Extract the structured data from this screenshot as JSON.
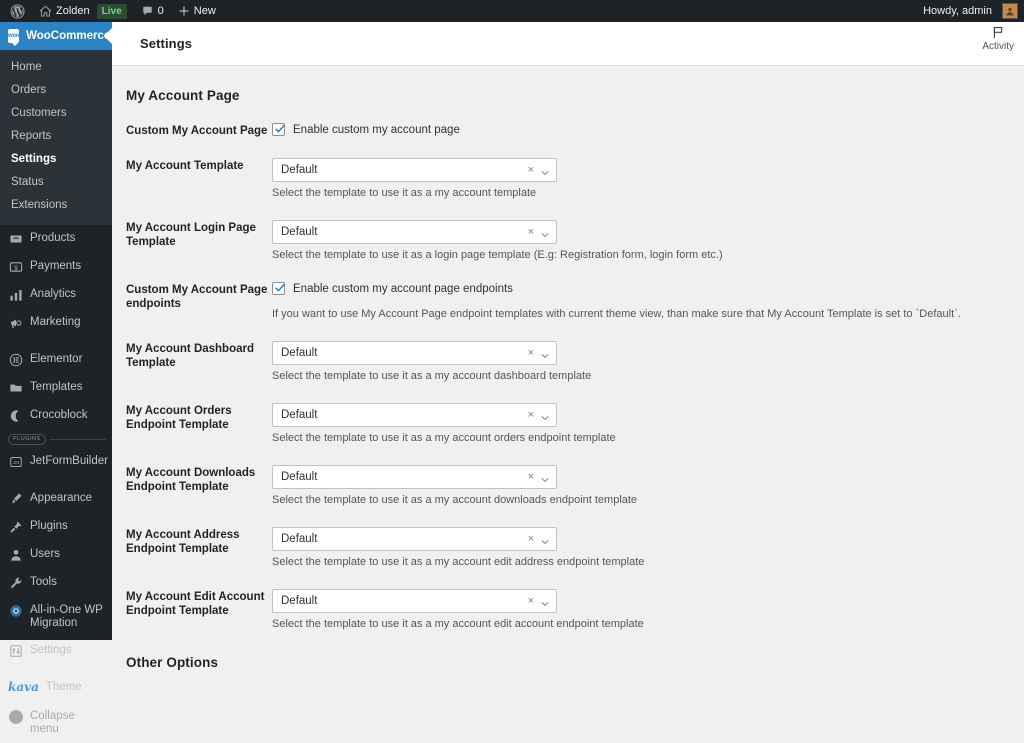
{
  "adminbar": {
    "wp_logo": "wordpress-logo-icon",
    "site_name": "Zolden",
    "live_badge": "Live",
    "comment_count": "0",
    "new_label": "New",
    "howdy": "Howdy, admin"
  },
  "sidebar": {
    "active_menu": "WooCommerce",
    "submenu": [
      {
        "label": "Home",
        "active": false
      },
      {
        "label": "Orders",
        "active": false
      },
      {
        "label": "Customers",
        "active": false
      },
      {
        "label": "Reports",
        "active": false
      },
      {
        "label": "Settings",
        "active": true
      },
      {
        "label": "Status",
        "active": false
      },
      {
        "label": "Extensions",
        "active": false
      }
    ],
    "group1": [
      {
        "label": "Products",
        "icon": "products-icon"
      },
      {
        "label": "Payments",
        "icon": "payments-icon"
      },
      {
        "label": "Analytics",
        "icon": "analytics-icon"
      },
      {
        "label": "Marketing",
        "icon": "marketing-megaphone-icon"
      }
    ],
    "group2": [
      {
        "label": "Elementor",
        "icon": "elementor-icon"
      },
      {
        "label": "Templates",
        "icon": "folder-icon"
      },
      {
        "label": "Crocoblock",
        "icon": "crocoblock-moon-icon"
      }
    ],
    "plugins_separator": "PLUGINS",
    "group3": [
      {
        "label": "JetFormBuilder",
        "icon": "jetformbuilder-icon"
      }
    ],
    "group4": [
      {
        "label": "Appearance",
        "icon": "appearance-brush-icon"
      },
      {
        "label": "Plugins",
        "icon": "plugins-plug-icon"
      },
      {
        "label": "Users",
        "icon": "users-icon"
      },
      {
        "label": "Tools",
        "icon": "tools-wrench-icon"
      },
      {
        "label": "All-in-One WP Migration",
        "icon": "migration-icon"
      },
      {
        "label": "Settings",
        "icon": "settings-sliders-icon"
      }
    ],
    "theme": {
      "brand": "kava",
      "label": "Theme"
    },
    "collapse": "Collapse menu"
  },
  "header": {
    "title": "Settings",
    "activity_label": "Activity",
    "activity_icon": "flag-icon"
  },
  "main": {
    "section_title": "My Account Page",
    "other_options_title": "Other Options",
    "select_clear_glyph": "×",
    "rows": [
      {
        "label": "Custom My Account Page",
        "type": "checkbox",
        "checked": true,
        "checkbox_label": "Enable custom my account page",
        "desc": ""
      },
      {
        "label": "My Account Template",
        "type": "select",
        "value": "Default",
        "desc": "Select the template to use it as a my account template"
      },
      {
        "label": "My Account Login Page Template",
        "type": "select",
        "value": "Default",
        "desc": "Select the template to use it as a login page template (E.g: Registration form, login form etc.)"
      },
      {
        "label": "Custom My Account Page endpoints",
        "type": "checkbox",
        "checked": true,
        "checkbox_label": "Enable custom my account page endpoints",
        "desc": "If you want to use My Account Page endpoint templates with current theme view, than make sure that My Account Template is set to `Default`."
      },
      {
        "label": "My Account Dashboard Template",
        "type": "select",
        "value": "Default",
        "desc": "Select the template to use it as a my account dashboard template"
      },
      {
        "label": "My Account Orders Endpoint Template",
        "type": "select",
        "value": "Default",
        "desc": "Select the template to use it as a my account orders endpoint template"
      },
      {
        "label": "My Account Downloads Endpoint Template",
        "type": "select",
        "value": "Default",
        "desc": "Select the template to use it as a my account downloads endpoint template"
      },
      {
        "label": "My Account Address Endpoint Template",
        "type": "select",
        "value": "Default",
        "desc": "Select the template to use it as a my account edit address endpoint template"
      },
      {
        "label": "My Account Edit Account Endpoint Template",
        "type": "select",
        "value": "Default",
        "desc": "Select the template to use it as a my account edit account endpoint template"
      }
    ]
  },
  "colors": {
    "admin_bar_bg": "#1d2327",
    "sidebar_bg": "#1d2327",
    "submenu_bg": "#2c3338",
    "accent_blue": "#2c83c3",
    "content_bg": "#f0f0f1",
    "badge_green": "#7ad08a"
  }
}
